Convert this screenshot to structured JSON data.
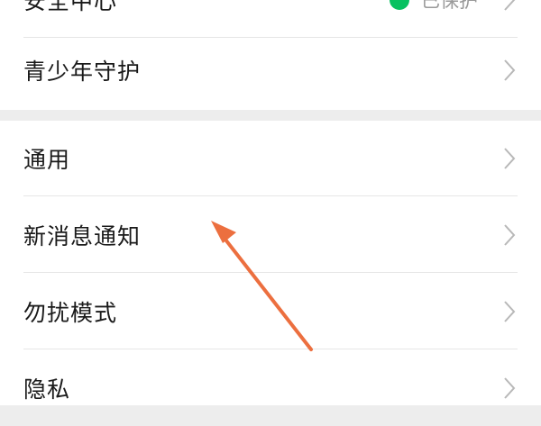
{
  "settings_top": [
    {
      "label": "安全中心",
      "status": "已保护"
    },
    {
      "label": "青少年守护"
    }
  ],
  "settings_bottom": [
    {
      "label": "通用"
    },
    {
      "label": "新消息通知"
    },
    {
      "label": "勿扰模式"
    },
    {
      "label": "隐私"
    }
  ],
  "colors": {
    "accent_green": "#07c160",
    "annotation_arrow": "#ec6f3f"
  },
  "icons": {
    "row_arrow": "chevron-right-icon",
    "status_indicator": "status-dot-icon"
  }
}
